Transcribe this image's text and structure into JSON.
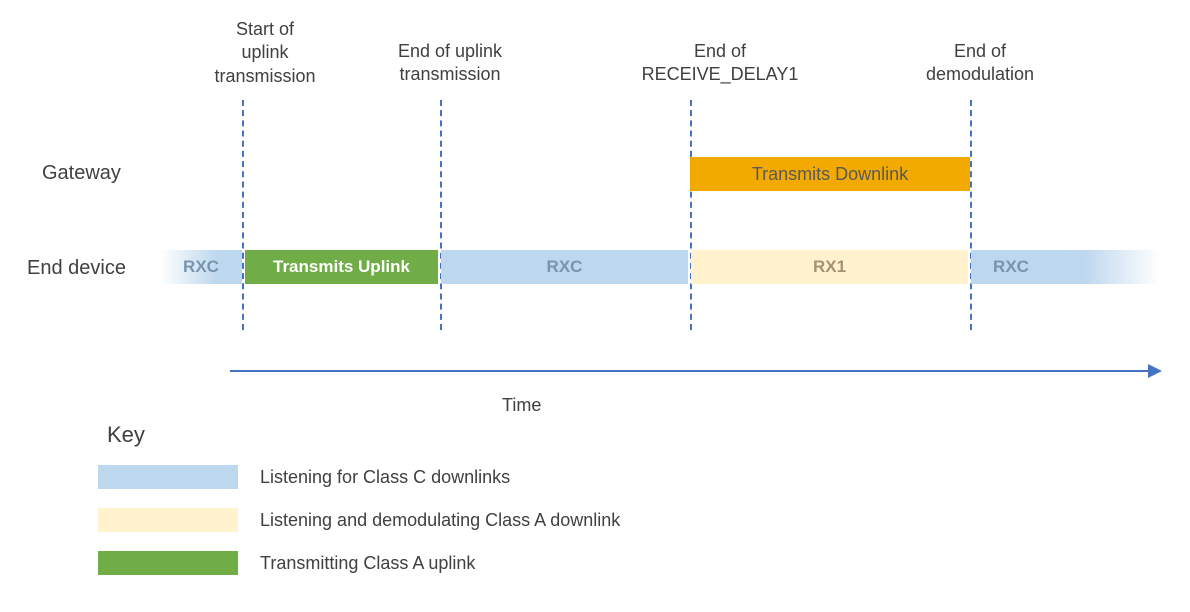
{
  "columns": {
    "start_uplink": "Start of\nuplink\ntransmission",
    "end_uplink": "End of uplink\ntransmission",
    "end_receive_delay1": "End of\nRECEIVE_DELAY1",
    "end_demod": "End of\ndemodulation"
  },
  "rows": {
    "gateway": "Gateway",
    "end_device": "End device"
  },
  "gateway": {
    "downlink_label": "Transmits Downlink"
  },
  "end_device": {
    "rxc_label": "RXC",
    "uplink_label": "Transmits Uplink",
    "rx1_label": "RX1"
  },
  "axis": {
    "time": "Time"
  },
  "key": {
    "title": "Key",
    "items": [
      "Listening for Class C downlinks",
      "Listening and demodulating Class A downlink",
      "Transmitting Class A uplink"
    ]
  },
  "diagram_data": {
    "type": "timeline",
    "lanes": [
      "Gateway",
      "End device"
    ],
    "events": [
      {
        "name": "Start of uplink transmission",
        "t": 0
      },
      {
        "name": "End of uplink transmission",
        "t": 1
      },
      {
        "name": "End of RECEIVE_DELAY1",
        "t": 2
      },
      {
        "name": "End of demodulation",
        "t": 3
      }
    ],
    "segments": {
      "Gateway": [
        {
          "label": "Transmits Downlink",
          "start": 2,
          "end": 3,
          "kind": "tx-downlink"
        }
      ],
      "End device": [
        {
          "label": "RXC",
          "start": -0.25,
          "end": 0,
          "kind": "listen-class-c"
        },
        {
          "label": "Transmits Uplink",
          "start": 0,
          "end": 1,
          "kind": "tx-uplink"
        },
        {
          "label": "RXC",
          "start": 1,
          "end": 2,
          "kind": "listen-class-c"
        },
        {
          "label": "RX1",
          "start": 2,
          "end": 3,
          "kind": "listen-class-a"
        },
        {
          "label": "RXC",
          "start": 3,
          "end": 3.5,
          "kind": "listen-class-c"
        }
      ]
    },
    "legend": {
      "listen-class-c": "Listening for Class C downlinks",
      "listen-class-a": "Listening and demodulating Class A downlink",
      "tx-uplink": "Transmitting Class A uplink"
    }
  }
}
